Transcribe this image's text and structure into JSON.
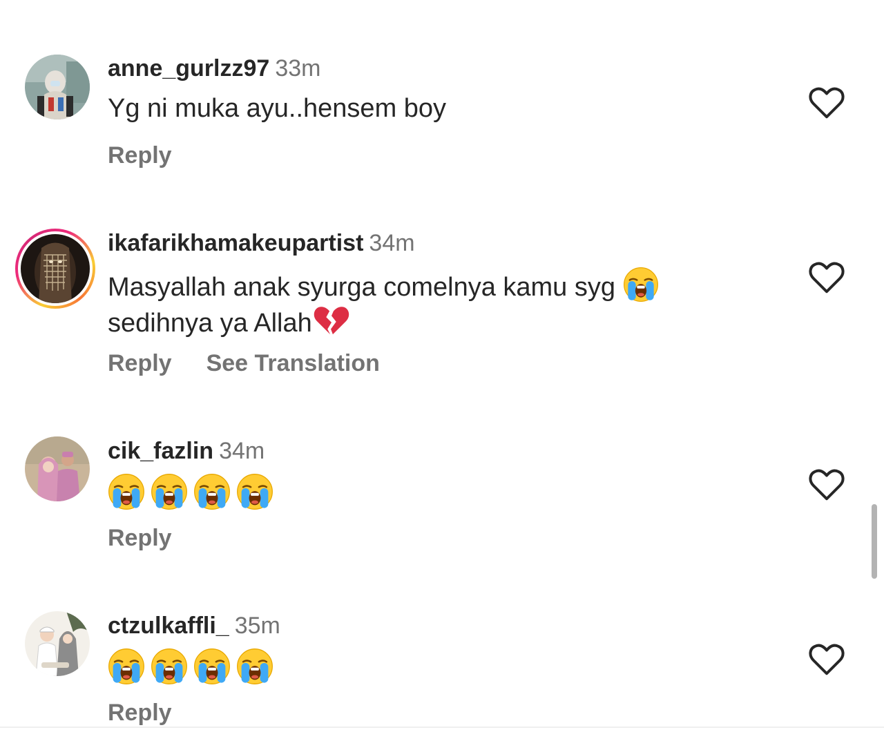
{
  "comments": [
    {
      "username": "anne_gurlzz97",
      "time": "33m",
      "text": "Yg ni muka ayu..hensem boy",
      "reply_label": "Reply",
      "avatar_icon": "user-avatar-hijab-icon",
      "has_story_ring": false
    },
    {
      "username": "ikafarikhamakeupartist",
      "time": "34m",
      "text_line1": "Masyallah anak syurga comelnya kamu syg",
      "text_line2": "sedihnya ya Allah",
      "emoji_after_line1": "loudly-crying-face-icon",
      "emoji_after_line2": "broken-heart-icon",
      "reply_label": "Reply",
      "translation_label": "See Translation",
      "avatar_icon": "user-avatar-veil-icon",
      "has_story_ring": true
    },
    {
      "username": "cik_fazlin",
      "time": "34m",
      "emojis": [
        "loudly-crying-face-icon",
        "loudly-crying-face-icon",
        "loudly-crying-face-icon",
        "loudly-crying-face-icon"
      ],
      "reply_label": "Reply",
      "avatar_icon": "user-avatar-couple-icon",
      "has_story_ring": false
    },
    {
      "username": "ctzulkaffli_",
      "time": "35m",
      "emojis": [
        "loudly-crying-face-icon",
        "loudly-crying-face-icon",
        "loudly-crying-face-icon",
        "loudly-crying-face-icon"
      ],
      "reply_label": "Reply",
      "avatar_icon": "user-avatar-illustrated-couple-icon",
      "has_story_ring": false
    }
  ],
  "colors": {
    "username": "#262626",
    "secondary_text": "#737373",
    "story_ring_gradient": [
      "#f9ce34",
      "#ee2a7b",
      "#6228d7"
    ],
    "emoji_yellow": "#ffcc33",
    "emoji_tear_blue": "#3fa9f5",
    "broken_heart_red": "#dd2e44"
  }
}
